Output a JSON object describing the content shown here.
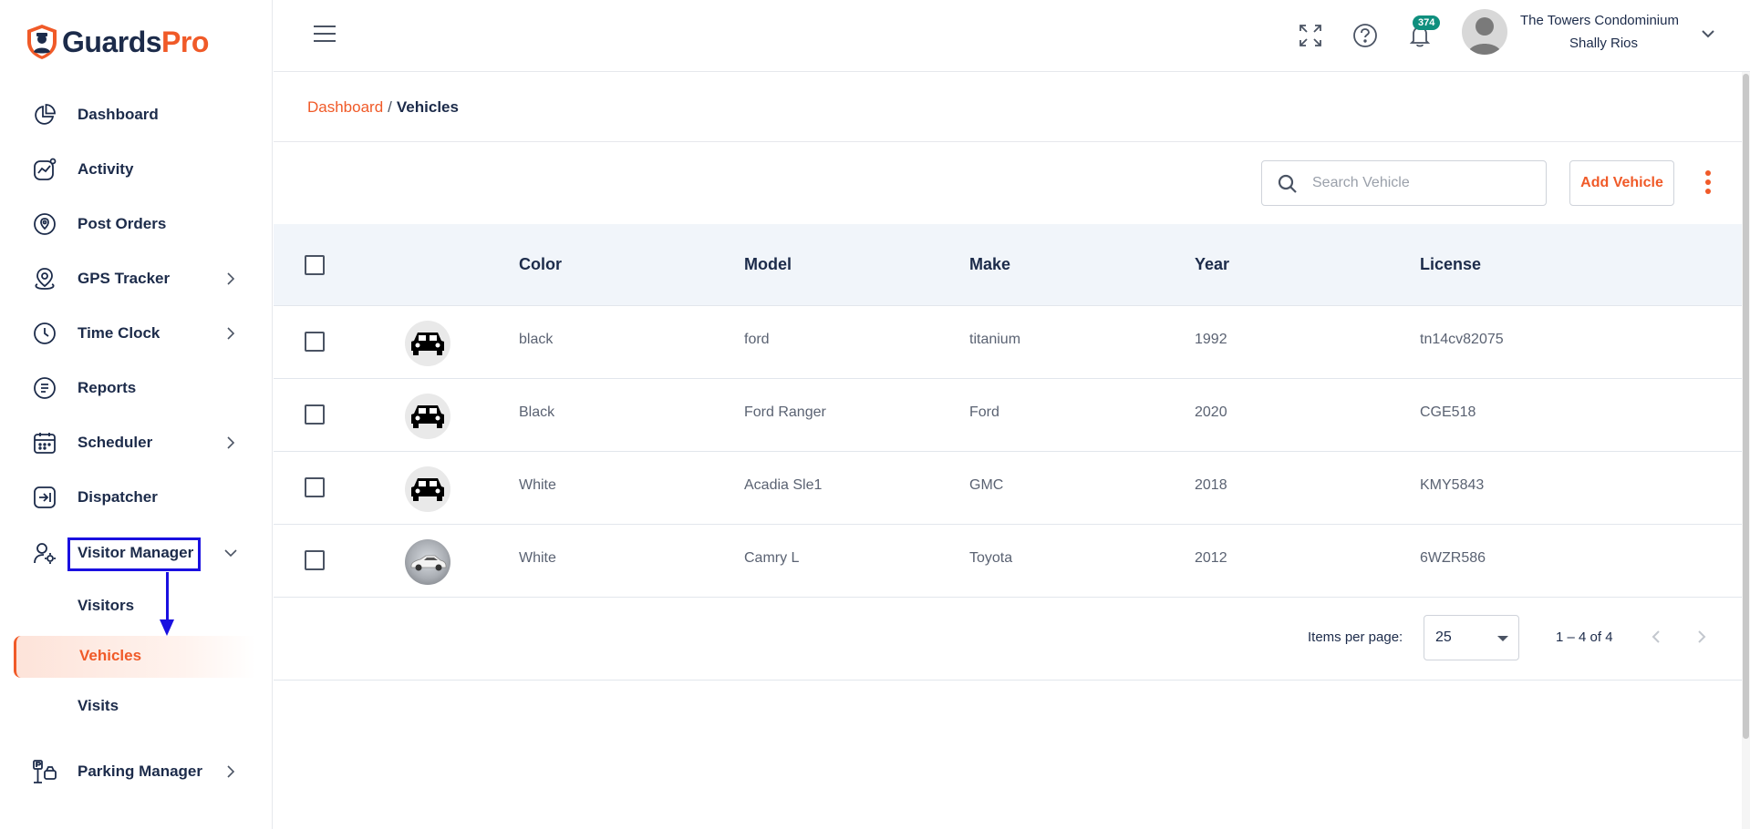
{
  "brand": {
    "name_part1": "Guards",
    "name_part2": "Pro",
    "accent": "#f05a28",
    "navy": "#1c2b4a"
  },
  "sidebar": {
    "items": [
      {
        "label": "Dashboard",
        "icon": "pie-chart-icon"
      },
      {
        "label": "Activity",
        "icon": "activity-graph-icon"
      },
      {
        "label": "Post Orders",
        "icon": "location-badge-icon"
      },
      {
        "label": "GPS Tracker",
        "icon": "map-pin-icon",
        "expandable": true
      },
      {
        "label": "Time Clock",
        "icon": "clock-icon",
        "expandable": true
      },
      {
        "label": "Reports",
        "icon": "report-list-icon"
      },
      {
        "label": "Scheduler",
        "icon": "calendar-icon",
        "expandable": true
      },
      {
        "label": "Dispatcher",
        "icon": "dispatch-arrow-icon"
      },
      {
        "label": "Visitor Manager",
        "icon": "user-gear-icon",
        "expanded": true
      },
      {
        "label": "Parking Manager",
        "icon": "parking-icon",
        "expandable": true
      }
    ],
    "visitor_sub": [
      {
        "label": "Visitors"
      },
      {
        "label": "Vehicles",
        "active": true
      },
      {
        "label": "Visits"
      }
    ]
  },
  "header": {
    "notification_count": "374",
    "org_name": "The Towers Condominium",
    "user_name": "Shally Rios"
  },
  "breadcrumb": {
    "parent": "Dashboard",
    "separator": "/",
    "current": "Vehicles"
  },
  "toolbar": {
    "search_placeholder": "Search Vehicle",
    "add_label": "Add Vehicle"
  },
  "table": {
    "headers": {
      "color": "Color",
      "model": "Model",
      "make": "Make",
      "year": "Year",
      "license": "License"
    },
    "rows": [
      {
        "color": "black",
        "model": "ford",
        "make": "titanium",
        "year": "1992",
        "license": "tn14cv82075",
        "image": "car-icon"
      },
      {
        "color": "Black",
        "model": "Ford Ranger",
        "make": "Ford",
        "year": "2020",
        "license": "CGE518",
        "image": "car-icon"
      },
      {
        "color": "White",
        "model": "Acadia Sle1",
        "make": "GMC",
        "year": "2018",
        "license": "KMY5843",
        "image": "car-icon"
      },
      {
        "color": "White",
        "model": "Camry L",
        "make": "Toyota",
        "year": "2012",
        "license": "6WZR586",
        "image": "car-photo"
      }
    ]
  },
  "pagination": {
    "items_per_page_label": "Items per page:",
    "items_per_page": "25",
    "range": "1 – 4 of 4"
  }
}
